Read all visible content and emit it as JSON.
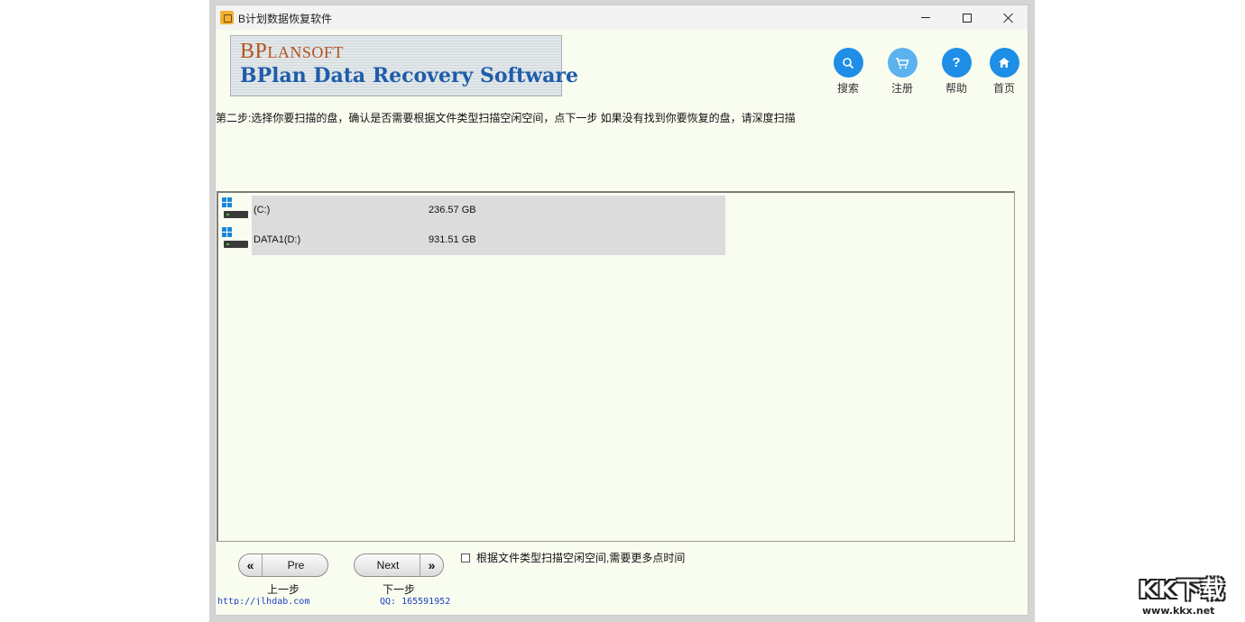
{
  "window": {
    "title": "B计划数据恢复软件"
  },
  "banner": {
    "brand_initials": "BP",
    "brand_rest": "LANSOFT",
    "product": "BPlan Data Recovery Software"
  },
  "toolbar": {
    "search_label": "搜索",
    "register_label": "注册",
    "help_label": "帮助",
    "help_glyph": "?",
    "home_label": "首页"
  },
  "instruction": "第二步:选择你要扫描的盘，确认是否需要根据文件类型扫描空闲空间，点下一步 如果没有找到你要恢复的盘，请深度扫描",
  "drives": [
    {
      "name": "(C:)",
      "size": "236.57 GB",
      "icon": "windows-drive-icon"
    },
    {
      "name": "DATA1(D:)",
      "size": "931.51 GB",
      "icon": "windows-drive-icon"
    }
  ],
  "nav": {
    "pre_label": "Pre",
    "pre_caption": "上一步",
    "next_label": "Next",
    "next_caption": "下一步"
  },
  "options": {
    "scan_free_space_label": "根据文件类型扫描空闲空间,需要更多点时间",
    "scan_free_space_checked": false
  },
  "footer": {
    "website": "http://jlhdab.com",
    "qq": "QQ: 165591952"
  },
  "watermark": {
    "main": "KK下载",
    "sub": "www.kkx.net"
  },
  "colors": {
    "window_bg": "#f9fdf0",
    "toolbar_accent": "#1e8ee6",
    "brand_orange": "#b3531e",
    "product_blue": "#1f5cab",
    "selection_gray": "#dcdcdc"
  }
}
